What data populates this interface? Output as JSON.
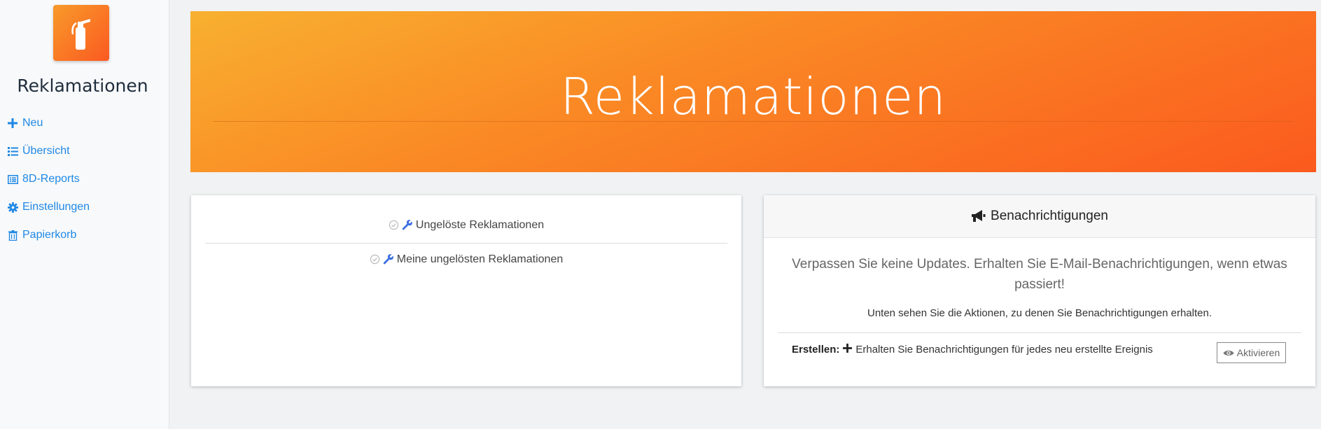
{
  "sidebar": {
    "title": "Reklamationen",
    "logo_icon": "fire-extinguisher-icon",
    "items": [
      {
        "label": "Neu",
        "icon": "plus-icon"
      },
      {
        "label": "Übersicht",
        "icon": "list-icon"
      },
      {
        "label": "8D-Reports",
        "icon": "table-list-icon"
      },
      {
        "label": "Einstellungen",
        "icon": "gear-icon"
      },
      {
        "label": "Papierkorb",
        "icon": "trash-icon"
      }
    ]
  },
  "hero": {
    "title": "Reklamationen"
  },
  "quick_links": {
    "items": [
      {
        "label": "Ungelöste Reklamationen",
        "icons": [
          "check-circle-icon",
          "wrench-icon"
        ]
      },
      {
        "label": "Meine ungelösten Reklamationen",
        "icons": [
          "check-circle-icon",
          "wrench-icon"
        ]
      }
    ]
  },
  "notifications": {
    "header": "Benachrichtigungen",
    "header_icon": "megaphone-icon",
    "lead": "Verpassen Sie keine Updates. Erhalten Sie E-Mail-Benachrichtigungen, wenn etwas passiert!",
    "sub": "Unten sehen Sie die Aktionen, zu denen Sie Benachrichtigungen erhalten.",
    "actions": [
      {
        "name": "Erstellen:",
        "description": "Erhalten Sie Benachrichtigungen für jedes neu erstellte Ereignis",
        "button_label": "Aktivieren",
        "button_icon": "eye-icon"
      }
    ]
  },
  "colors": {
    "accent": "#1e88e5",
    "brand_gradient_start": "#f8b030",
    "brand_gradient_end": "#fb5a1e"
  }
}
